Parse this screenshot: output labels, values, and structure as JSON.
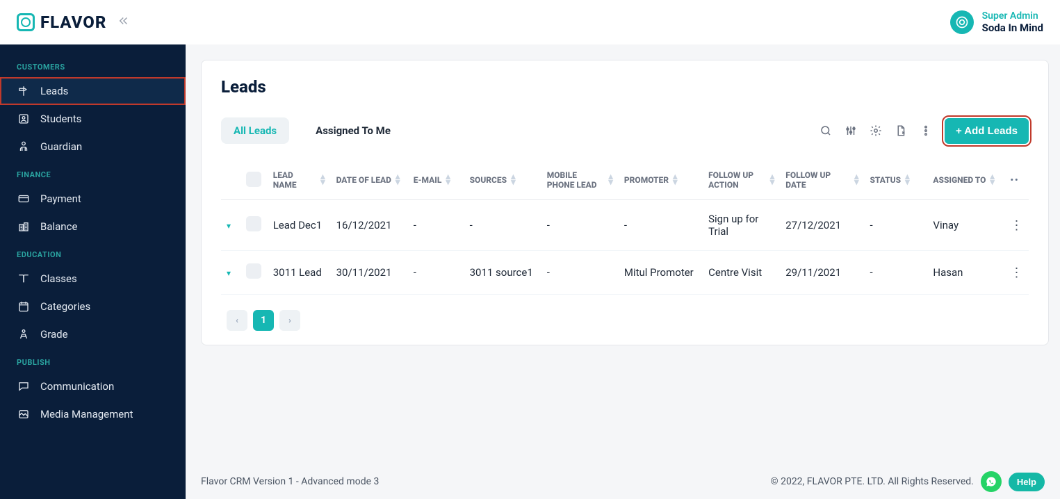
{
  "brand": {
    "name": "FLAVOR"
  },
  "user": {
    "role": "Super Admin",
    "name": "Soda In Mind"
  },
  "sidebar": {
    "section_customers": "CUSTOMERS",
    "section_finance": "FINANCE",
    "section_education": "EDUCATION",
    "section_publish": "PUBLISH",
    "leads": "Leads",
    "students": "Students",
    "guardian": "Guardian",
    "payment": "Payment",
    "balance": "Balance",
    "classes": "Classes",
    "categories": "Categories",
    "grade": "Grade",
    "communication": "Communication",
    "media_management": "Media Management"
  },
  "page": {
    "title": "Leads"
  },
  "tabs": {
    "all_leads": "All Leads",
    "assigned_to_me": "Assigned To Me"
  },
  "toolbar": {
    "add_leads": "+ Add Leads"
  },
  "table": {
    "headers": {
      "lead_name": "LEAD NAME",
      "date_of_lead": "DATE OF LEAD",
      "email": "E-MAIL",
      "sources": "SOURCES",
      "mobile_phone_lead": "MOBILE PHONE LEAD",
      "promoter": "PROMOTER",
      "follow_up_action": "FOLLOW UP ACTION",
      "follow_up_date": "FOLLOW UP DATE",
      "status": "STATUS",
      "assigned_to": "ASSIGNED TO"
    },
    "rows": [
      {
        "lead_name": "Lead Dec1",
        "date_of_lead": "16/12/2021",
        "email": "-",
        "sources": "-",
        "mobile_phone_lead": "-",
        "promoter": "-",
        "follow_up_action": "Sign up for Trial",
        "follow_up_date": "27/12/2021",
        "status": "-",
        "assigned_to": "Vinay"
      },
      {
        "lead_name": "3011 Lead",
        "date_of_lead": "30/11/2021",
        "email": "-",
        "sources": "3011 source1",
        "mobile_phone_lead": "-",
        "promoter": "Mitul Promoter",
        "follow_up_action": "Centre Visit",
        "follow_up_date": "29/11/2021",
        "status": "-",
        "assigned_to": "Hasan"
      }
    ]
  },
  "pagination": {
    "current": "1"
  },
  "footer": {
    "left": "Flavor CRM Version 1 - Advanced mode 3",
    "right": "© 2022, FLAVOR PTE. LTD. All Rights Reserved.",
    "help": "Help"
  }
}
